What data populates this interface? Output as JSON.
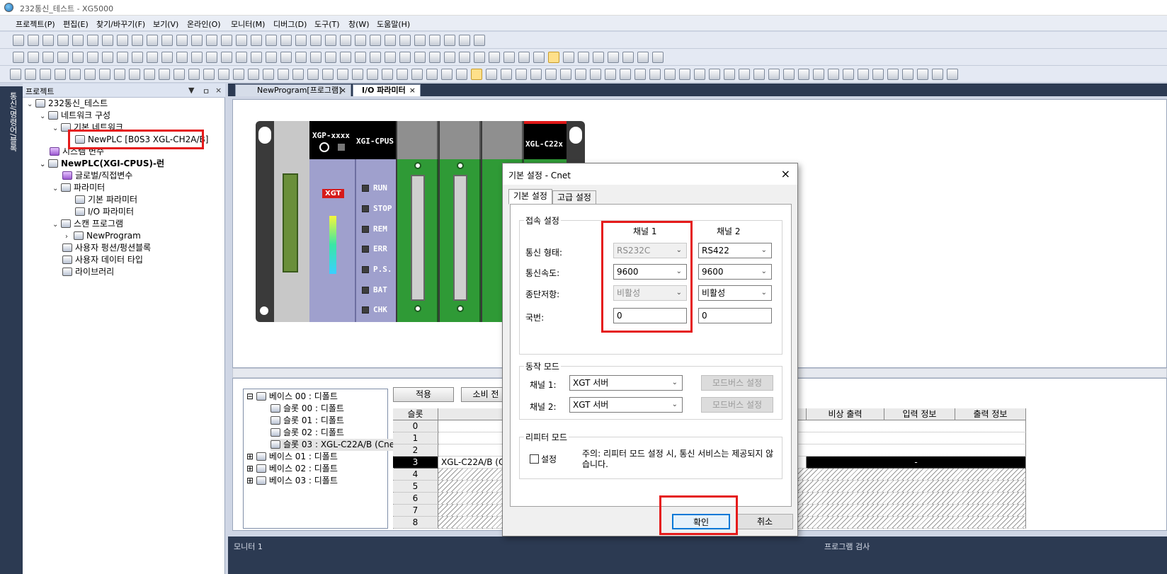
{
  "window": {
    "title": "232통신_테스트 - XG5000"
  },
  "menu": [
    "프로젝트(P)",
    "편집(E)",
    "찾기/바꾸기(F)",
    "보기(V)",
    "온라인(O)",
    "모니터(M)",
    "디버그(D)",
    "도구(T)",
    "창(W)",
    "도움말(H)"
  ],
  "side_tab": "통신/명령어/블록",
  "project_panel": {
    "title": "프로젝트",
    "controls": [
      "▼",
      "ㅁ",
      "×"
    ],
    "tree": [
      {
        "label": "232통신_테스트"
      },
      {
        "label": "네트워크 구성"
      },
      {
        "label": "기본 네트워크"
      },
      {
        "label": "NewPLC [B0S3 XGL-CH2A/B]"
      },
      {
        "label": "시스템 변수"
      },
      {
        "label": "NewPLC(XGI-CPUS)-런"
      },
      {
        "label": "글로벌/직접변수"
      },
      {
        "label": "파라미터"
      },
      {
        "label": "기본 파라미터"
      },
      {
        "label": "I/O 파라미터"
      },
      {
        "label": "스캔 프로그램"
      },
      {
        "label": "NewProgram"
      },
      {
        "label": "사용자 펑션/펑션블록"
      },
      {
        "label": "사용자 데이터 타입"
      },
      {
        "label": "라이브러리"
      }
    ]
  },
  "tabs": [
    {
      "label": "NewProgram[프로그램]",
      "close": "×"
    },
    {
      "label": "I/O 파라미터",
      "close": "×"
    }
  ],
  "rack": {
    "cpu_model": "XGP-xxxx",
    "cpu_name": "XGI-CPUS",
    "brand": "XGT",
    "leds": [
      "RUN",
      "STOP",
      "REM",
      "ERR",
      "P.S.",
      "BAT",
      "CHK"
    ],
    "slot3_label": "XGL-C22x"
  },
  "bottom": {
    "tree": [
      {
        "label": "베이스 00 : 디폴트"
      },
      {
        "label": "슬롯 00 : 디폴트"
      },
      {
        "label": "슬롯 01 : 디폴트"
      },
      {
        "label": "슬롯 02 : 디폴트"
      },
      {
        "label": "슬롯 03 : XGL-C22A/B (Cne"
      },
      {
        "label": "베이스 01 : 디폴트"
      },
      {
        "label": "베이스 02 : 디폴트"
      },
      {
        "label": "베이스 03 : 디폴트"
      }
    ],
    "buttons": [
      "적용",
      "소비 전"
    ],
    "columns": [
      "슬롯",
      "",
      "비상 출력",
      "입력 정보",
      "출력 정보"
    ],
    "rows": [
      "0",
      "1",
      "2",
      "3",
      "4",
      "5",
      "6",
      "7",
      "8"
    ],
    "row3_module": "XGL-C22A/B (C",
    "row3_emergency": "-"
  },
  "bottom_strip": {
    "left": "모니터 1",
    "right": "프로그램 검사"
  },
  "dialog": {
    "title": "기본 설정 - Cnet",
    "close": "×",
    "tabs": [
      "기본 설정",
      "고급 설정"
    ],
    "connection": {
      "group": "접속 설정",
      "ch1_header": "채널 1",
      "ch2_header": "채널 2",
      "labels": [
        "통신 형태:",
        "통신속도:",
        "종단저항:",
        "국번:"
      ],
      "ch1": {
        "type": "RS232C",
        "speed": "9600",
        "termination": "비활성",
        "station": "0"
      },
      "ch2": {
        "type": "RS422",
        "speed": "9600",
        "termination": "비활성",
        "station": "0"
      }
    },
    "operation": {
      "group": "동작 모드",
      "ch1_label": "채널 1:",
      "ch2_label": "채널 2:",
      "ch1_value": "XGT 서버",
      "ch2_value": "XGT 서버",
      "modbus_btn": "모드버스 설정"
    },
    "repeater": {
      "group": "리피터 모드",
      "check_label": "설정",
      "note": "주의: 리피터 모드 설정 시, 통신 서비스는 제공되지 않습니다."
    },
    "ok": "확인",
    "cancel": "취소"
  },
  "colors": {
    "highlight_box": "#e51b1b",
    "dark_chrome": "#2c3a52",
    "cpu": "#9fa0cd",
    "io": "#2f9a36"
  }
}
